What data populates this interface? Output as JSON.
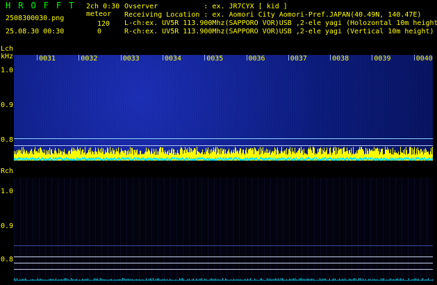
{
  "header": {
    "brand": "HROFFT",
    "filename": "2508300030.png",
    "datetime": "25.08.30 00:30",
    "channel_label": "2ch 0:30",
    "meteor_label": "meteor",
    "meteor_count_top": "120",
    "meteor_count_bottom": "0",
    "observer": "Ovserver           : ex. JR7CYX [ kid ]",
    "location": "Receiving Location : ex. Aomori City Aomori-Pref.JAPAN(40.49N, 140.47E)",
    "lch_info": "L-ch:ex. UV5R 113.900Mhz(SAPPORO VOR)USB ,2-ele yagi (Holozontal 10m height",
    "rch_info": "R-ch:ex. UV5R 113.900Mhz(SAPPORO VOR)USB ,2-ele yagi (Vertical 10m height)"
  },
  "lch": {
    "label": "Lch",
    "unit": "kHz",
    "y_ticks": [
      "1.0",
      "0.9",
      "0.8"
    ],
    "time_labels": [
      "0031",
      "0032",
      "0033",
      "0034",
      "0035",
      "0036",
      "0037",
      "0038",
      "0039",
      "0040"
    ]
  },
  "rch": {
    "label": "Rch",
    "y_ticks": [
      "1.0",
      "0.9",
      "0.8"
    ]
  },
  "colors": {
    "text": "#ffff00",
    "brand": "#00ff00",
    "spectrogram": "#0a1a7a",
    "signal_line": "#8fd6ff",
    "level_yellow": "#ffff00",
    "level_cyan": "#00e0ff"
  }
}
